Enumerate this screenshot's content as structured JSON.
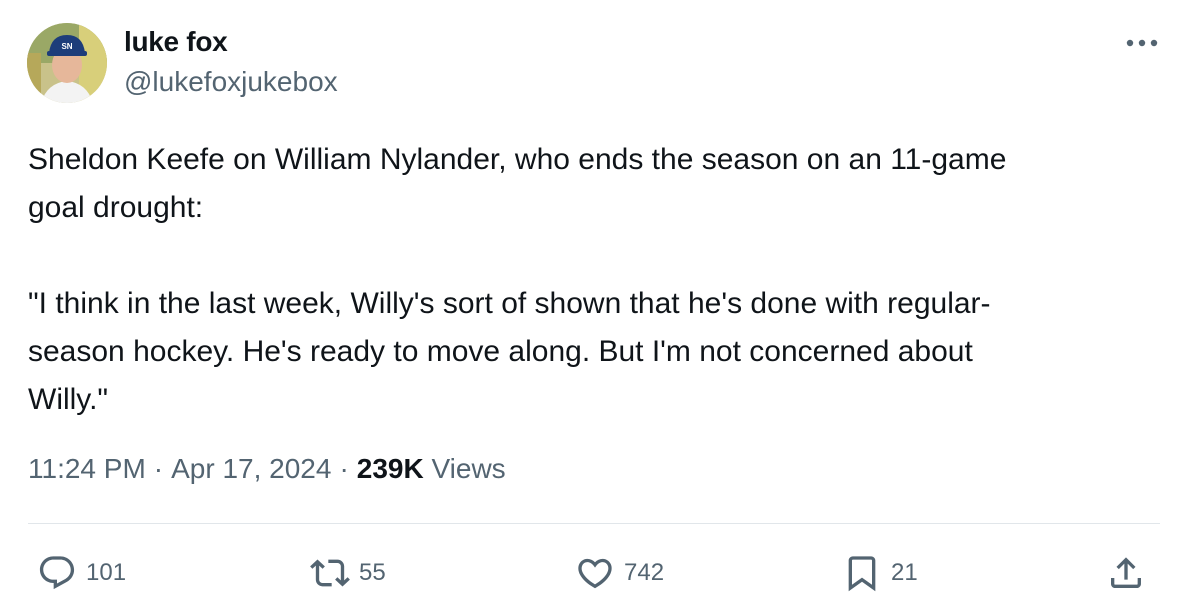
{
  "author": {
    "name": "luke fox",
    "handle": "@lukefoxjukebox",
    "avatar_icon": "user-photo-icon",
    "cap_text": "SN"
  },
  "tweet": {
    "text": "Sheldon Keefe on William Nylander, who ends the season on an 11-game\ngoal drought:\n\n\"I think in the last week, Willy's sort of shown that he's done with regular-\nseason hockey. He's ready to move along. But I'm not concerned about\nWilly.\""
  },
  "meta": {
    "time": "11:24 PM",
    "separator": "·",
    "date": "Apr 17, 2024",
    "views_count": "239K",
    "views_label": "Views"
  },
  "actions": {
    "replies": {
      "icon": "reply-icon",
      "count": "101"
    },
    "retweets": {
      "icon": "retweet-icon",
      "count": "55"
    },
    "likes": {
      "icon": "heart-icon",
      "count": "742"
    },
    "bookmarks": {
      "icon": "bookmark-icon",
      "count": "21"
    },
    "share": {
      "icon": "share-icon"
    }
  },
  "colors": {
    "text": "#0f1419",
    "secondary": "#536471",
    "divider": "#e1e6ea"
  }
}
